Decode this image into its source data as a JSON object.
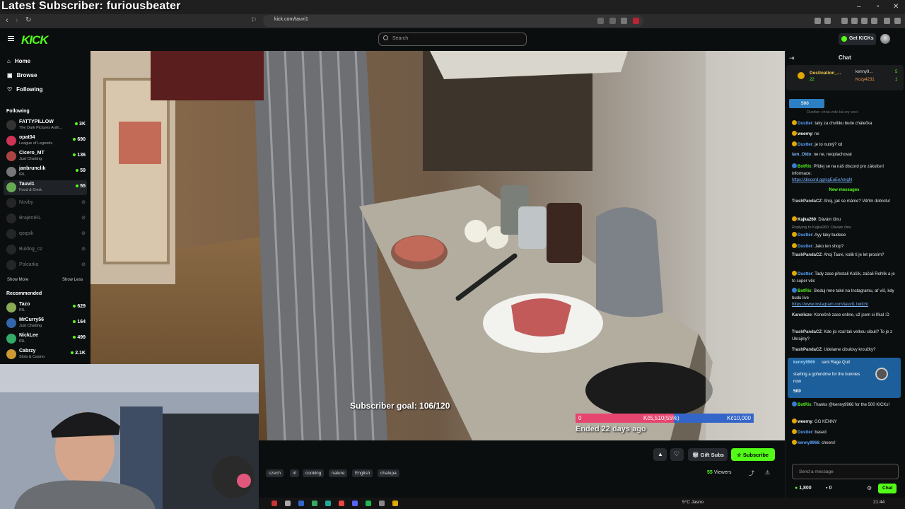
{
  "overlay": {
    "latest_subscriber": "Latest Subscriber: furiousbeater"
  },
  "browser": {
    "url": "kick.com/tauvi1"
  },
  "header": {
    "search_placeholder": "Search",
    "get_kicks": "Get KICKs"
  },
  "sidebar": {
    "nav": [
      "Home",
      "Browse",
      "Following"
    ],
    "following_title": "Following",
    "following": [
      {
        "name": "FATTYPILLOW",
        "category": "The Dark Pictures Anth...",
        "viewers": "3K",
        "online": true
      },
      {
        "name": "opat04",
        "category": "League of Legends",
        "viewers": "690",
        "online": true
      },
      {
        "name": "Cicero_MT",
        "category": "Just Chatting",
        "viewers": "136",
        "online": true
      },
      {
        "name": "janbrunclik",
        "category": "IRL",
        "viewers": "59",
        "online": true
      },
      {
        "name": "Tauvi1",
        "category": "Food & Drink",
        "viewers": "55",
        "online": true
      },
      {
        "name": "Novby",
        "category": "",
        "viewers": "",
        "online": false
      },
      {
        "name": "BrajenIRL",
        "category": "",
        "viewers": "",
        "online": false
      },
      {
        "name": "qoqsik",
        "category": "",
        "viewers": "",
        "online": false
      },
      {
        "name": "Buldog_cz",
        "category": "",
        "viewers": "",
        "online": false
      },
      {
        "name": "Polcarka",
        "category": "",
        "viewers": "",
        "online": false
      }
    ],
    "show_more": "Show More",
    "show_less": "Show Less",
    "recommended_title": "Recommended",
    "recommended": [
      {
        "name": "Tazo",
        "category": "IRL",
        "viewers": "629"
      },
      {
        "name": "MrCurry56",
        "category": "Just Chatting",
        "viewers": "164"
      },
      {
        "name": "NickLee",
        "category": "IRL",
        "viewers": "499"
      },
      {
        "name": "Cabrzy",
        "category": "Slots & Casino",
        "viewers": "2.1K"
      }
    ]
  },
  "stream": {
    "subscriber_goal": "Subscriber goal: 106/120",
    "goal_start": "0",
    "goal_progress_label": "Kč5,510(55%)",
    "goal_end": "Kč10,000",
    "goal_fraction": 0.55,
    "goal_status": "Ended 22 days ago",
    "tags": [
      "czech",
      "irl",
      "cooking",
      "nature",
      "English",
      "chalupa"
    ],
    "viewers_count": "55",
    "viewers_label": "Viewers",
    "gift_subs": "Gift Subs",
    "subscribe": "Subscribe"
  },
  "chat": {
    "title": "Chat",
    "pinned_top": {
      "name": "Destination_...",
      "sub": "22",
      "right1": "kenny9...",
      "right1_n": "5",
      "right2": "Kozy4231",
      "right2_n": "1"
    },
    "kicks_amount": "500",
    "messages": [
      {
        "user": "Dustter",
        "text": "taky za chvíliku bude chálečka"
      },
      {
        "user": "weerny",
        "text": "ne"
      },
      {
        "user": "Dustter",
        "text": "je to nutný? xd"
      },
      {
        "user": "Iam_Oldo",
        "text": "ne ne, neoplachovat"
      },
      {
        "user": "BotRix",
        "text": "Přidej se na náš discord pro zákulisní informace:",
        "link": "https://discord.gg/cgEuEeAmgN"
      },
      {
        "user": "TrashPandaCZ",
        "text": "Ahoj, jak se máme? Věřím dobrotu!"
      },
      {
        "user": "Kajka260",
        "text": "Dávám činu"
      },
      {
        "user": "Dustter",
        "text": "Ayy taky budeee",
        "reply": "Replying to Kajka260: Dávám činu"
      },
      {
        "user": "Dustter",
        "text": "Jako ten shop?"
      },
      {
        "user": "TrashPandaCZ",
        "text": "Ahoj Tauvi, kolik ti je let prosím?"
      },
      {
        "user": "Dustter",
        "text": "Tady zase přestali Košík, začali Rohlík a je to super věc"
      },
      {
        "user": "BotRix",
        "text": "Sleduj mne také na Instagramu, ať víš, kdy budu live",
        "link": "https://www.instagram.com/tauvi1.twitch/"
      },
      {
        "user": "Kanolicze",
        "text": "Konečně zase online, už jsem si říkal :D"
      },
      {
        "user": "TrashPandaCZ",
        "text": "Kde jsi vzal tak velkou cibuli? To je z Ukrajiny?"
      },
      {
        "user": "TrashPandaCZ",
        "text": "Udelame cibulovy kroužky?"
      },
      {
        "user": "BotRix",
        "text": "Thanks @kenny9966 for the 500 KICKs!"
      },
      {
        "user": "weerny",
        "text": "GG KENNY"
      },
      {
        "user": "Dustter",
        "text": "based"
      },
      {
        "user": "kenny9966",
        "text": "cheers!"
      }
    ],
    "new_messages_label": "New messages",
    "partial_top": "Dustter: chná vole ká ory veci",
    "gift": {
      "user": "kenny9966",
      "action": "sent Rage Quit",
      "message": "starting a gofundme for the bunnies now",
      "amount": "500"
    },
    "input_placeholder": "Send a message",
    "balance": "1,800",
    "balance2": "0",
    "send": "Chat"
  },
  "taskbar": {
    "weather": "5°C Jasno",
    "time": "21:44"
  },
  "colors": {
    "brand": "#53fc18",
    "bg": "#0b0e0f",
    "goal_pink": "#e6456f",
    "goal_blue": "#3465c9"
  }
}
